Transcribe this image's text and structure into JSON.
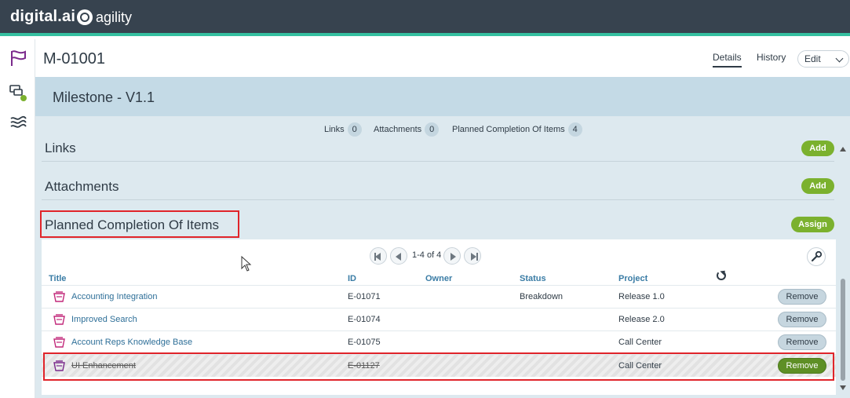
{
  "topbar": {
    "brand": "digital.ai",
    "product": "agility"
  },
  "header": {
    "item_id": "M-01001",
    "tabs": [
      "Details",
      "History"
    ],
    "edit_label": "Edit"
  },
  "panel": {
    "title": "Milestone - V1.1",
    "summary": [
      {
        "label": "Links",
        "count": "0"
      },
      {
        "label": "Attachments",
        "count": "0"
      },
      {
        "label": "Planned Completion Of Items",
        "count": "4"
      }
    ]
  },
  "sections": {
    "links": {
      "title": "Links",
      "button": "Add"
    },
    "attachments": {
      "title": "Attachments",
      "button": "Add"
    },
    "planned": {
      "title": "Planned Completion Of Items",
      "button": "Assign"
    }
  },
  "table": {
    "pager_text": "1-4 of 4",
    "columns": [
      "Title",
      "ID",
      "Owner",
      "Status",
      "Project"
    ],
    "rows": [
      {
        "title": "Accounting Integration",
        "id": "E-01071",
        "owner": "",
        "status": "Breakdown",
        "project": "Release 1.0",
        "action": "Remove",
        "closed": false
      },
      {
        "title": "Improved Search",
        "id": "E-01074",
        "owner": "",
        "status": "",
        "project": "Release 2.0",
        "action": "Remove",
        "closed": false
      },
      {
        "title": "Account Reps Knowledge Base",
        "id": "E-01075",
        "owner": "",
        "status": "",
        "project": "Call Center",
        "action": "Remove",
        "closed": false
      },
      {
        "title": "UI Enhancement",
        "id": "E-01127",
        "owner": "",
        "status": "",
        "project": "Call Center",
        "action": "Remove",
        "closed": true
      }
    ]
  },
  "colors": {
    "topbar": "#37434f",
    "accent_teal": "#35c0a0",
    "green_button": "#7bb12e",
    "highlight_red": "#e0242a",
    "link_blue": "#2e6f98"
  },
  "icons": [
    "flag-icon",
    "conversation-icon",
    "waves-icon",
    "wrench-icon",
    "refresh-icon",
    "epic-icon"
  ]
}
